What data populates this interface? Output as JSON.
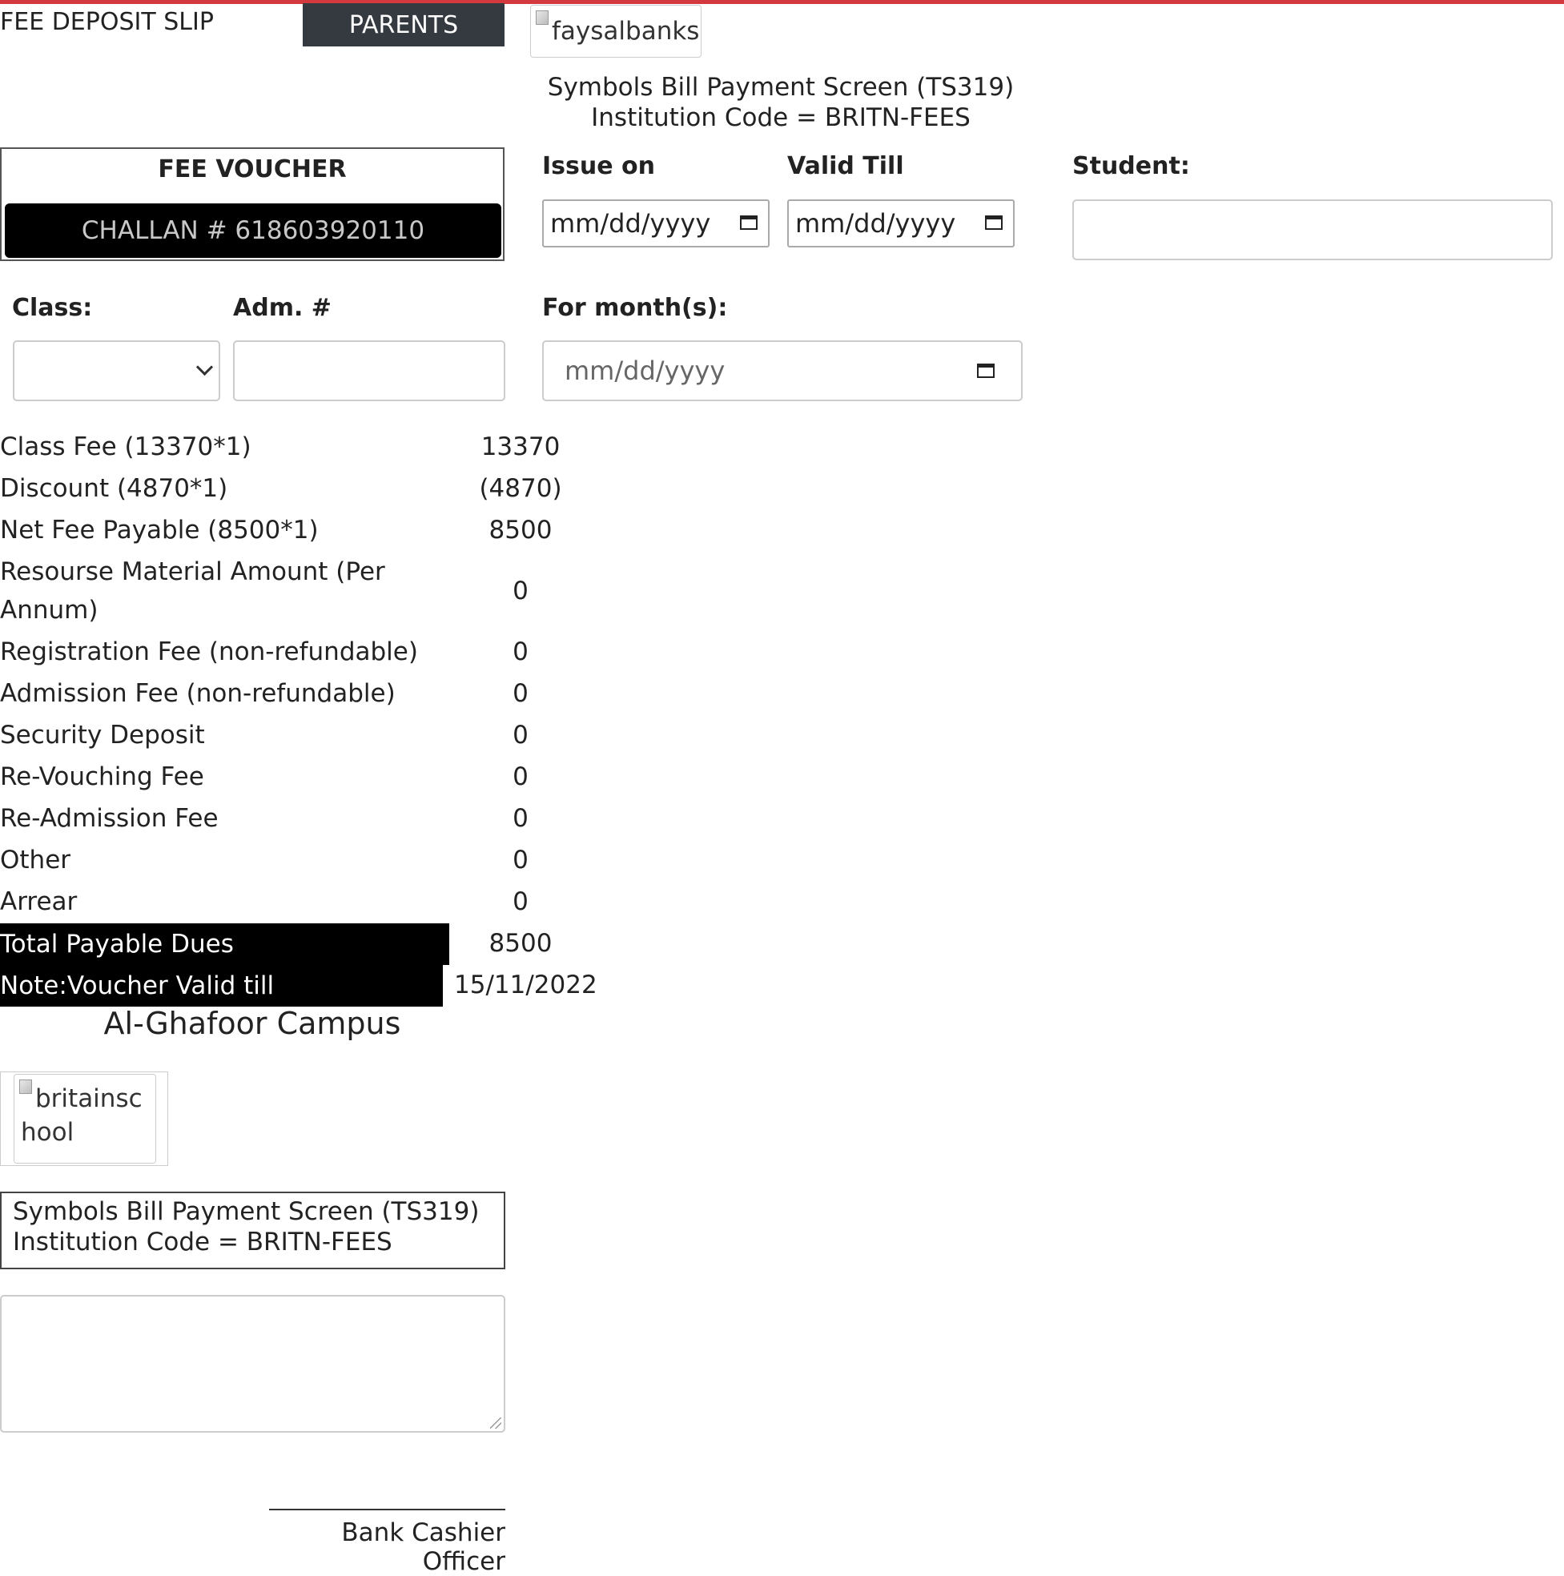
{
  "header": {
    "slip_title": "FEE DEPOSIT SLIP",
    "parents_button": "PARENTS",
    "bank_logo_alt": "faysalbanks"
  },
  "payment_info": {
    "line1": "Symbols Bill Payment Screen (TS319)",
    "line2": "Institution Code = BRITN-FEES"
  },
  "voucher": {
    "title": "FEE VOUCHER",
    "challan": "CHALLAN # 618603920110"
  },
  "form": {
    "issue_on_label": "Issue on",
    "issue_on_value": "mm/dd/yyyy",
    "valid_till_label": "Valid Till",
    "valid_till_value": "mm/dd/yyyy",
    "student_label": "Student:",
    "student_value": "",
    "class_label": "Class:",
    "class_value": "",
    "adm_label": "Adm. #",
    "adm_value": "",
    "month_label": "For month(s):",
    "month_value": "mm/dd/yyyy"
  },
  "fees": [
    {
      "label": "Class Fee (13370*1)",
      "value": "13370"
    },
    {
      "label": "Discount (4870*1)",
      "value": "(4870)"
    },
    {
      "label": "Net Fee Payable (8500*1)",
      "value": "8500"
    },
    {
      "label_line1": "Resourse Material Amount (Per",
      "label_line2": "Annum)",
      "value": "0"
    },
    {
      "label": "Registration Fee (non-refundable)",
      "value": "0"
    },
    {
      "label": "Admission Fee (non-refundable)",
      "value": "0"
    },
    {
      "label": "Security Deposit",
      "value": "0"
    },
    {
      "label": "Re-Vouching Fee",
      "value": "0"
    },
    {
      "label": "Re-Admission Fee",
      "value": "0"
    },
    {
      "label": "Other",
      "value": "0"
    },
    {
      "label": "Arrear",
      "value": "0"
    }
  ],
  "total": {
    "label": "Total Payable Dues",
    "value": "8500"
  },
  "note": {
    "label": "Note:Voucher Valid till",
    "value": "15/11/2022"
  },
  "campus": "Al-Ghafoor Campus",
  "school_logo_alt_line1": "britainsc",
  "school_logo_alt_line2": "hool",
  "footer_info": {
    "line1": "Symbols Bill Payment Screen (TS319)",
    "line2": "Institution Code = BRITN-FEES"
  },
  "remarks_value": "",
  "signature_label": "Bank Cashier Officer",
  "colors": {
    "top_bar": "#d33a3f",
    "parents_button": "#343a40",
    "black_rows": "#000000"
  },
  "icons": [
    "calendar-icon",
    "chevron-down-icon",
    "broken-image-icon",
    "resize-grip-icon"
  ]
}
